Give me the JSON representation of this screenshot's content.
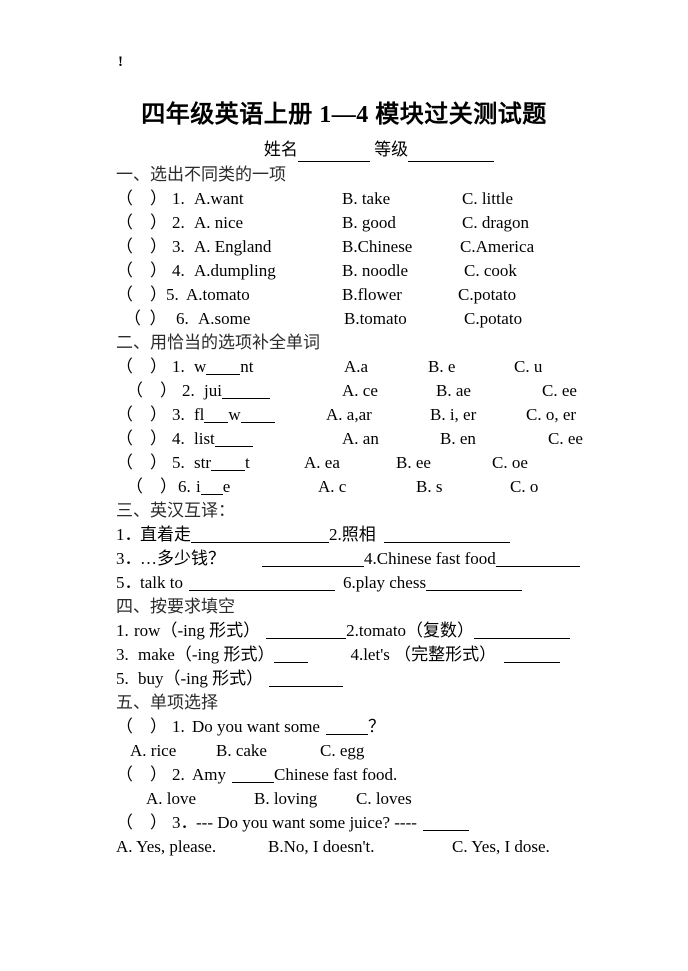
{
  "document": {
    "top_mark": "!",
    "title": "四年级英语上册 1—4 模块过关测试题",
    "name_label": "姓名",
    "grade_label": "等级"
  },
  "sections": [
    {
      "heading": "一、选出不同类的一项",
      "items": [
        {
          "paren": "（    ）",
          "num": "1.",
          "a": "A.want",
          "b": "B. take",
          "c": "C. little"
        },
        {
          "paren": "（    ）",
          "num": "2.",
          "a": "A. nice",
          "b": "B. good",
          "c": "C. dragon"
        },
        {
          "paren": "（    ）",
          "num": "3.",
          "a": "A. England",
          "b": "B.Chinese",
          "c": "C.America"
        },
        {
          "paren": "（    ）",
          "num": "4.",
          "a": "A.dumpling",
          "b": "B. noodle",
          "c": "C. cook"
        },
        {
          "paren": "（    ）",
          "num": "5.",
          "a": "A.tomato",
          "b": "B.flower",
          "c": "C.potato"
        },
        {
          "paren": "（  ）",
          "num": "6.",
          "a": "A.some",
          "b": "B.tomato",
          "c": "C.potato"
        }
      ]
    },
    {
      "heading": "二、用恰当的选项补全单词",
      "items": [
        {
          "paren": "（    ）",
          "num": "1.",
          "stem_pre": "w",
          "stem_post": "nt",
          "a": "A.a",
          "b": "B. e",
          "c": "C. u"
        },
        {
          "paren": "（    ）",
          "num": "2.",
          "stem_pre": "jui",
          "stem_post": "",
          "a": "A. ce",
          "b": "B. ae",
          "c": "C. ee"
        },
        {
          "paren": "（    ）",
          "num": "3.",
          "stem_pre": "fl",
          "stem_post": "w",
          "a": "A. a,ar",
          "b": "B. i, er",
          "c": "C. o, er"
        },
        {
          "paren": "（    ）",
          "num": "4.",
          "stem_pre": "list",
          "stem_post": "",
          "a": "A. an",
          "b": "B. en",
          "c": "C. ee"
        },
        {
          "paren": "（    ）",
          "num": "5.",
          "stem_pre": "str",
          "stem_post": "t",
          "a": "A. ea",
          "b": "B. ee",
          "c": "C. oe"
        },
        {
          "paren": "（    ）",
          "num": "6.",
          "stem_pre": "i",
          "stem_post": "e",
          "a": "A. c",
          "b": "B. s",
          "c": "C. o"
        }
      ]
    },
    {
      "heading": "三、英汉互译：",
      "pairs": [
        {
          "left_num": "1．",
          "left": "直着走",
          "right_num": "2.",
          "right": "照相"
        },
        {
          "left_num": "3．",
          "left": "…多少钱？",
          "right_num": "4.",
          "right": "Chinese fast food"
        },
        {
          "left_num": "5．",
          "left": "talk to",
          "right_num": "6.",
          "right": "play chess"
        }
      ]
    },
    {
      "heading": "四、按要求填空",
      "pairs": [
        {
          "left_num": "1.",
          "left": "row（-ing 形式）",
          "right_num": "2.",
          "right": "tomato（复数）"
        },
        {
          "left_num": "3.",
          "left": "make（-ing 形式）",
          "right_num": "4.",
          "right": "let's （完整形式）"
        },
        {
          "left_num": "5.",
          "left": "buy（-ing 形式）",
          "right_num": "",
          "right": ""
        }
      ]
    },
    {
      "heading": "五、单项选择",
      "questions": [
        {
          "paren": "（    ）",
          "num": "1.",
          "stem_pre": "Do you want some",
          "stem_post": "？",
          "a": "A. rice",
          "b": "B. cake",
          "c": "C. egg"
        },
        {
          "paren": "（    ）",
          "num": "2.",
          "stem_pre": "Amy",
          "stem_post": "Chinese fast food.",
          "a": "A. love",
          "b": "B. loving",
          "c": "C. loves"
        },
        {
          "paren": "（    ）",
          "num": "3．",
          "stem_pre": "--- Do you want some juice? ----",
          "stem_post": "",
          "a": "A. Yes, please.",
          "b": "B.No, I doesn't.",
          "c": "C. Yes, I dose."
        }
      ]
    }
  ]
}
